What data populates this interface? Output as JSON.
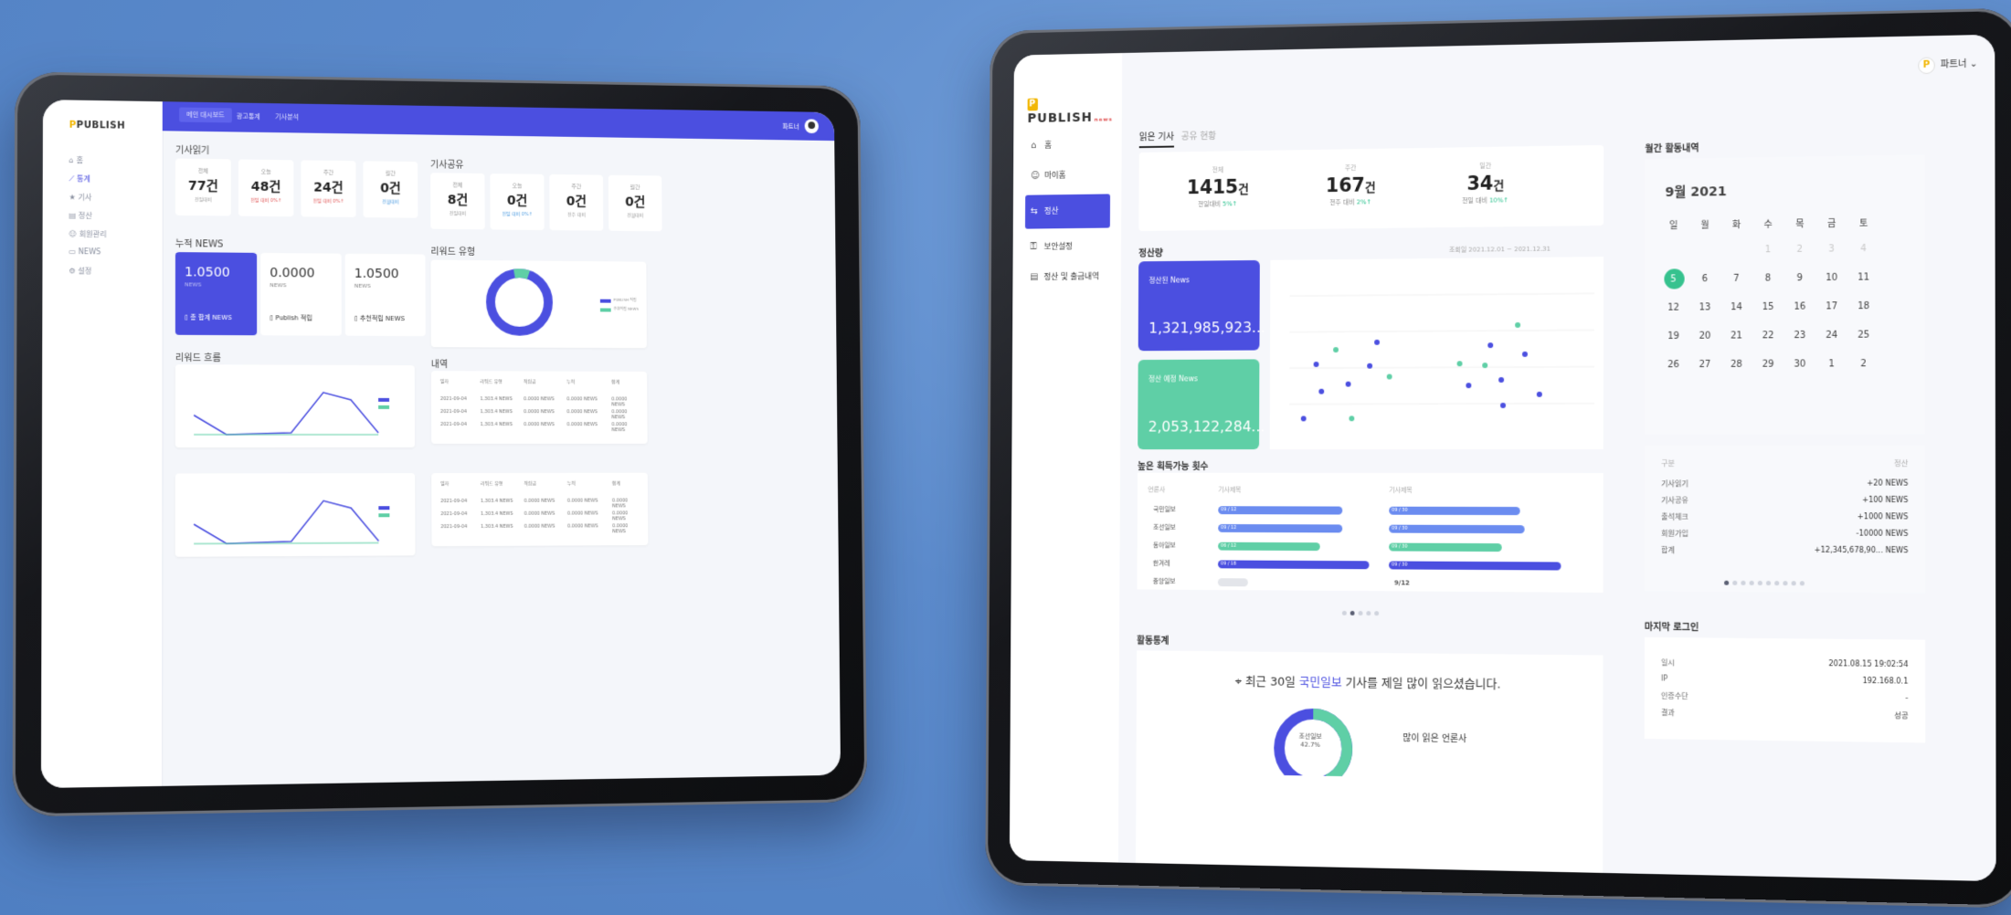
{
  "colors": {
    "accent": "#4b4fe0",
    "green": "#5fcfa6",
    "bg": "#5f8ed0"
  },
  "left": {
    "logo": "PUBLISH",
    "nav": [
      "홈",
      "통계",
      "기사",
      "정산",
      "회원관리",
      "NEWS",
      "설정"
    ],
    "tabs": [
      "메인 대시보드",
      "광고통계",
      "기사분석"
    ],
    "user_label": "파트너",
    "section_read": "기사읽기",
    "section_share": "기사공유",
    "read_stats": [
      {
        "k": "전체",
        "v": "77건",
        "s": "전일대비"
      },
      {
        "k": "오늘",
        "v": "48건",
        "s": "전일 대비 0%↑"
      },
      {
        "k": "주간",
        "v": "24건",
        "s": "전일 대비 0%↑"
      },
      {
        "k": "월간",
        "v": "0건",
        "s": "전월대비"
      }
    ],
    "share_stats": [
      {
        "k": "전체",
        "v": "8건",
        "s": "전일대비"
      },
      {
        "k": "오늘",
        "v": "0건",
        "s": "전일 대비 0%↑"
      },
      {
        "k": "주간",
        "v": "0건",
        "s": "전주 대비"
      },
      {
        "k": "월간",
        "v": "0건",
        "s": "전월대비"
      }
    ],
    "section_news": "누적 NEWS",
    "news": [
      {
        "v": "1.0500",
        "u": "NEWS",
        "b": "총 합계 NEWS"
      },
      {
        "v": "0.0000",
        "u": "NEWS",
        "b": "Publish 적립"
      },
      {
        "v": "1.0500",
        "u": "NEWS",
        "b": "추천적립 NEWS"
      }
    ],
    "section_reward": "리워드 유형",
    "legend": [
      "PUBLISH 적립",
      "추천적립 NEWS"
    ],
    "section_graph": "리워드 흐름",
    "section_list": "내역",
    "table_header": [
      "일자",
      "리워드 유형",
      "적립금",
      "누적",
      "합계"
    ],
    "table_rows": [
      [
        "2021-09-04",
        "1,303.4 NEWS",
        "0.0000 NEWS",
        "0.0000 NEWS",
        "0.0000 NEWS"
      ],
      [
        "2021-09-04",
        "1,303.4 NEWS",
        "0.0000 NEWS",
        "0.0000 NEWS",
        "0.0000 NEWS"
      ],
      [
        "2021-09-04",
        "1,303.4 NEWS",
        "0.0000 NEWS",
        "0.0000 NEWS",
        "0.0000 NEWS"
      ]
    ]
  },
  "right": {
    "logo": "PUBLISH",
    "logo_sub": "news",
    "user": "파트너",
    "nav": [
      {
        "label": "홈",
        "icon": "⌂"
      },
      {
        "label": "마이홈",
        "icon": "☺"
      },
      {
        "label": "정산",
        "icon": "⇆"
      },
      {
        "label": "보안설정",
        "icon": "⚿"
      },
      {
        "label": "정산 및 출금내역",
        "icon": "▤"
      }
    ],
    "tabs": [
      "읽은 기사",
      "공유 현황"
    ],
    "stats": [
      {
        "k": "전체",
        "v": "1415",
        "unit": "건",
        "s": "전일대비",
        "d": "5%↑"
      },
      {
        "k": "주간",
        "v": "167",
        "unit": "건",
        "s": "전주 대비",
        "d": "2%↑"
      },
      {
        "k": "일간",
        "v": "34",
        "unit": "건",
        "s": "전일 대비",
        "d": "10%↑"
      }
    ],
    "section_settle": "정산량",
    "settle_range": "조회일 2021.12.01 ~ 2021.12.31",
    "cards": [
      {
        "k": "정산된 News",
        "v": "1,321,985,923..."
      },
      {
        "k": "정산 예정 News",
        "v": "2,053,122,284..."
      }
    ],
    "section_top": "높은 획득가능 횟수",
    "col_head": [
      "언론사",
      "기사제목"
    ],
    "press": [
      "국민일보",
      "조선일보",
      "동아일보",
      "한겨레",
      "중앙일보"
    ],
    "bars_left": [
      "09 / 12",
      "09 / 12",
      "06 / 12",
      "09 / 18",
      ""
    ],
    "bars_right": [
      "09 / 30",
      "09 / 30",
      "09 / 30",
      "09 / 30"
    ],
    "bars_right_last": "9/12",
    "section_stats": "활동통계",
    "insight_pre": "최근 30일 ",
    "insight_hl": "국민일보",
    "insight_post": " 기사를 제일 많이 읽으셨습니다.",
    "donut_lbl": "조선일보",
    "donut_pct": "42.7%",
    "most_read": "많이 읽은 언론사",
    "section_month": "월간 활동내역",
    "cal_title": "9월 2021",
    "weekdays": [
      "일",
      "월",
      "화",
      "수",
      "목",
      "금",
      "토"
    ],
    "act_head": [
      "구분",
      "정산"
    ],
    "activities": [
      {
        "k": "기사읽기",
        "v": "+20 NEWS"
      },
      {
        "k": "기사공유",
        "v": "+100 NEWS"
      },
      {
        "k": "출석체크",
        "v": "+1000 NEWS"
      },
      {
        "k": "회원가입",
        "v": "-10000 NEWS"
      },
      {
        "k": "합계",
        "v": "+12,345,678,90... NEWS"
      }
    ],
    "section_login": "마지막 로그인",
    "login": [
      {
        "k": "일시",
        "v": "2021.08.15 19:02:54"
      },
      {
        "k": "IP",
        "v": "192.168.0.1"
      },
      {
        "k": "인증수단",
        "v": "-"
      },
      {
        "k": "결과",
        "v": "성공"
      }
    ]
  }
}
